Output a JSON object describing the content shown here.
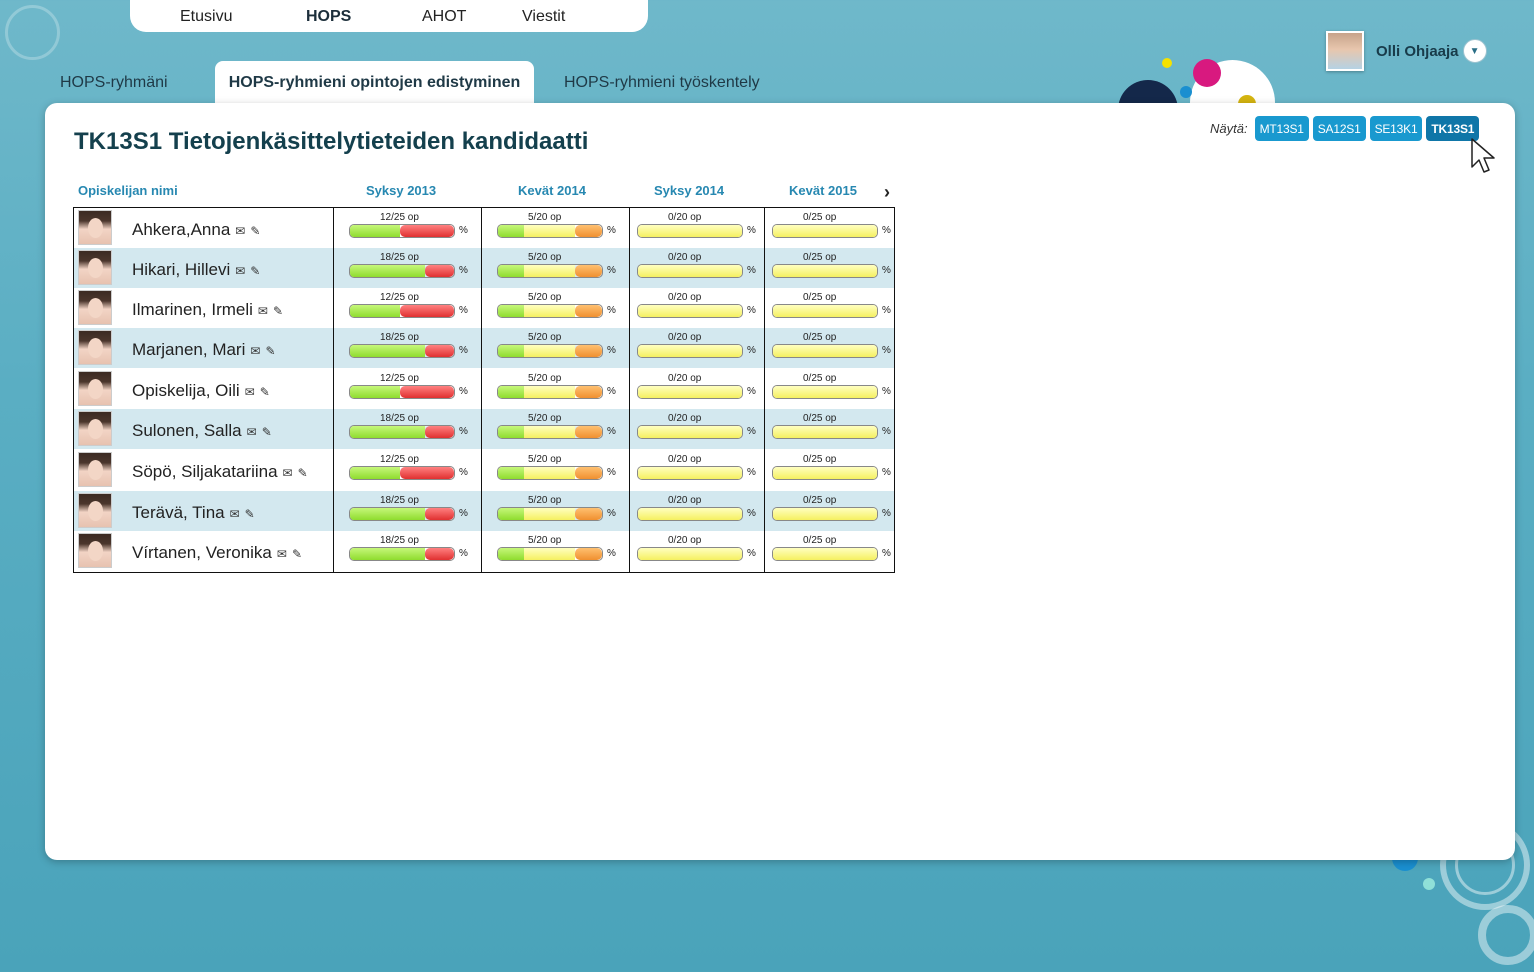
{
  "top_nav": [
    {
      "label": "Etusivu",
      "active": false
    },
    {
      "label": "HOPS",
      "active": true
    },
    {
      "label": "AHOT",
      "active": false
    },
    {
      "label": "Viestit",
      "active": false
    }
  ],
  "user": {
    "name": "Olli Ohjaaja"
  },
  "sub_tabs": [
    {
      "label": "HOPS-ryhmäni",
      "active": false
    },
    {
      "label": "HOPS-ryhmieni opintojen edistyminen",
      "active": true
    },
    {
      "label": "HOPS-ryhmieni työskentely",
      "active": false
    }
  ],
  "page": {
    "title": "TK13S1 Tietojenkäsittelytieteiden kandidaatti",
    "show_label": "Näytä:",
    "groups": [
      {
        "label": "MT13S1",
        "active": false
      },
      {
        "label": "SA12S1",
        "active": false
      },
      {
        "label": "SE13K1",
        "active": false
      },
      {
        "label": "TK13S1",
        "active": true
      }
    ]
  },
  "table": {
    "name_header": "Opiskelijan nimi",
    "terms": [
      "Syksy 2013",
      "Kevät 2014",
      "Syksy 2014",
      "Kevät 2015"
    ],
    "percent_sign": "%",
    "students": [
      {
        "name": "Ahkera,Anna",
        "credits": [
          "12/25 op",
          "5/20 op",
          "0/20 op",
          "0/25 op"
        ]
      },
      {
        "name": "Hikari, Hillevi",
        "credits": [
          "18/25 op",
          "5/20 op",
          "0/20 op",
          "0/25 op"
        ]
      },
      {
        "name": "Ilmarinen, Irmeli",
        "credits": [
          "12/25 op",
          "5/20 op",
          "0/20 op",
          "0/25 op"
        ]
      },
      {
        "name": "Marjanen, Mari",
        "credits": [
          "18/25 op",
          "5/20 op",
          "0/20 op",
          "0/25 op"
        ]
      },
      {
        "name": "Opiskelija, Oili",
        "credits": [
          "12/25 op",
          "5/20 op",
          "0/20 op",
          "0/25 op"
        ]
      },
      {
        "name": "Sulonen, Salla",
        "credits": [
          "18/25 op",
          "5/20 op",
          "0/20 op",
          "0/25 op"
        ]
      },
      {
        "name": "Söpö, Siljakatariina",
        "credits": [
          "12/25 op",
          "5/20 op",
          "0/20 op",
          "0/25 op"
        ]
      },
      {
        "name": "Terävä, Tina",
        "credits": [
          "18/25 op",
          "5/20 op",
          "0/20 op",
          "0/25 op"
        ]
      },
      {
        "name": "Vírtanen, Veronika",
        "credits": [
          "18/25 op",
          "5/20 op",
          "0/20 op",
          "0/25 op"
        ]
      }
    ]
  },
  "icons": {
    "mail": "mail-icon",
    "edit": "pencil-icon",
    "next": "chevron-right-icon",
    "dropdown": "chevron-down-icon"
  },
  "colors": {
    "accent": "#1999cf",
    "title": "#14404d",
    "header": "#2788b1",
    "alt_row": "#d3e8ef"
  }
}
